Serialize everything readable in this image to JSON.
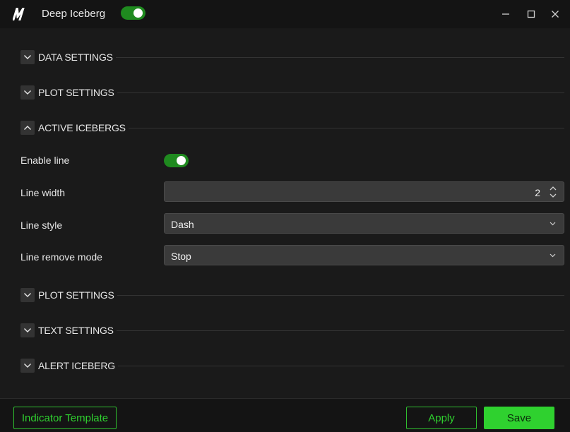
{
  "window": {
    "title": "Deep Iceberg",
    "enabled": true
  },
  "sections": [
    {
      "label": "DATA SETTINGS",
      "expanded": false
    },
    {
      "label": "PLOT SETTINGS",
      "expanded": false
    },
    {
      "label": "ACTIVE ICEBERGS",
      "expanded": true
    },
    {
      "label": "PLOT SETTINGS",
      "expanded": false
    },
    {
      "label": "TEXT SETTINGS",
      "expanded": false
    },
    {
      "label": "ALERT ICEBERG",
      "expanded": false
    }
  ],
  "active_icebergs": {
    "enable_line": {
      "label": "Enable line",
      "value": true
    },
    "line_width": {
      "label": "Line width",
      "value": "2"
    },
    "line_style": {
      "label": "Line style",
      "value": "Dash"
    },
    "line_remove_mode": {
      "label": "Line remove mode",
      "value": "Stop"
    }
  },
  "footer": {
    "template_label": "Indicator Template",
    "apply_label": "Apply",
    "save_label": "Save"
  },
  "colors": {
    "accent": "#2fd12f",
    "toggle_on": "#1f8a1f",
    "background": "#1a1a1a",
    "field": "#3a3a3a"
  },
  "icons": {
    "logo": "m-logo-icon",
    "minimize": "minimize-icon",
    "maximize": "maximize-icon",
    "close": "close-icon",
    "collapsed": "chevron-down-icon",
    "expanded": "chevron-up-icon",
    "spinner": "spinner-arrows-icon",
    "dropdown": "chevron-down-icon"
  }
}
